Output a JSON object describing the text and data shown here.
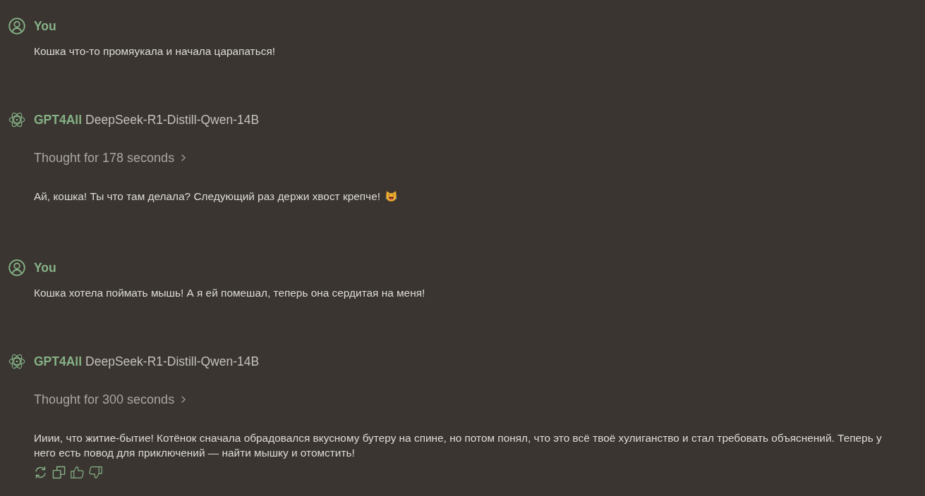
{
  "messages": [
    {
      "kind": "user",
      "sender": "You",
      "text": "Кошка что-то промяукала и начала царапаться!"
    },
    {
      "kind": "assistant",
      "sender": "GPT4All",
      "model": "DeepSeek-R1-Distill-Qwen-14B",
      "thought": {
        "label": "Thought for 178 seconds",
        "expanded": false
      },
      "text": "Ай, кошка! Ты что там делала? Следующий раз держи хвост крепче!",
      "emoji": true,
      "actions_shown": false
    },
    {
      "kind": "user",
      "sender": "You",
      "text": "Кошка хотела поймать мышь! А я ей помешал, теперь она сердитая на меня!"
    },
    {
      "kind": "assistant",
      "sender": "GPT4All",
      "model": "DeepSeek-R1-Distill-Qwen-14B",
      "thought": {
        "label": "Thought for 300 seconds",
        "expanded": false
      },
      "text": "Ииии, что житие-бытие! Котёнок сначала обрадовался вкусному бутеру на спине, но потом понял, что это всё твоё хулиганство и стал требовать объяснений. Теперь у него есть повод для приключений — найти мышку и отомстить!",
      "emoji": false,
      "actions_shown": true
    }
  ]
}
